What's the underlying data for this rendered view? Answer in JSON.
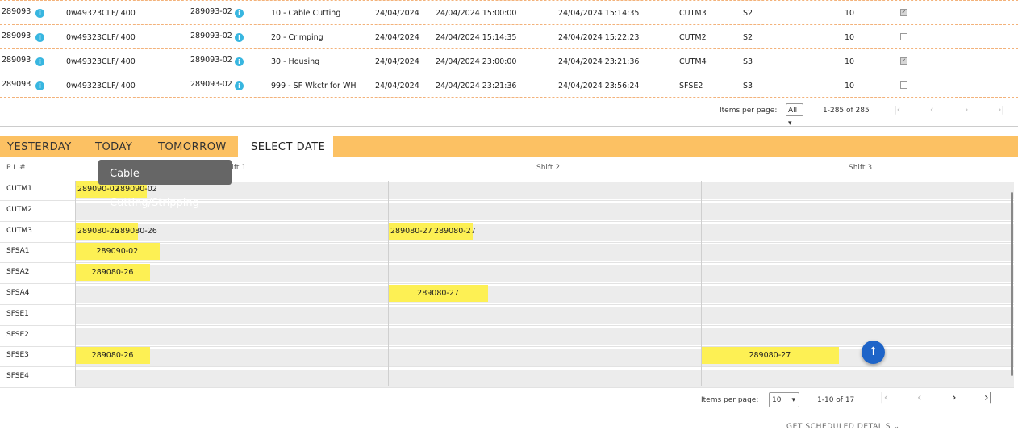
{
  "top_table": {
    "rows": [
      {
        "order": "289093",
        "part": "0w49323CLF/ 400",
        "wo": "289093-02",
        "op": "10 - Cable Cutting",
        "date": "24/04/2024",
        "start": "24/04/2024 15:00:00",
        "end": "24/04/2024 15:14:35",
        "machine": "CUTM3",
        "shift": "S2",
        "qty": "10",
        "checked": true
      },
      {
        "order": "289093",
        "part": "0w49323CLF/ 400",
        "wo": "289093-02",
        "op": "20 - Crimping",
        "date": "24/04/2024",
        "start": "24/04/2024 15:14:35",
        "end": "24/04/2024 15:22:23",
        "machine": "CUTM2",
        "shift": "S2",
        "qty": "10",
        "checked": false
      },
      {
        "order": "289093",
        "part": "0w49323CLF/ 400",
        "wo": "289093-02",
        "op": "30 - Housing",
        "date": "24/04/2024",
        "start": "24/04/2024 23:00:00",
        "end": "24/04/2024 23:21:36",
        "machine": "CUTM4",
        "shift": "S3",
        "qty": "10",
        "checked": true
      },
      {
        "order": "289093",
        "part": "0w49323CLF/ 400",
        "wo": "289093-02",
        "op": "999 - SF Wkctr for WH",
        "date": "24/04/2024",
        "start": "24/04/2024 23:21:36",
        "end": "24/04/2024 23:56:24",
        "machine": "SFSE2",
        "shift": "S3",
        "qty": "10",
        "checked": false
      }
    ],
    "info_icon": "info-icon",
    "pager": {
      "label": "Items per page:",
      "selected": "All",
      "range": "1-285 of 285"
    }
  },
  "tabs": [
    {
      "label": "YESTERDAY",
      "active": false
    },
    {
      "label": "TODAY",
      "active": false
    },
    {
      "label": "TOMORROW",
      "active": false
    },
    {
      "label": "SELECT DATE",
      "active": true
    }
  ],
  "gantt": {
    "row_header": "P L #",
    "shifts": [
      "Shift 1",
      "Shift 2",
      "Shift 3"
    ],
    "rows": [
      {
        "label": "CUTM1",
        "bars": [
          {
            "shift": 0,
            "start": 0.0,
            "end": 0.23,
            "labels": [
              "289090-02",
              "289090-02"
            ]
          }
        ]
      },
      {
        "label": "CUTM2",
        "bars": []
      },
      {
        "label": "CUTM3",
        "bars": [
          {
            "shift": 0,
            "start": 0.0,
            "end": 0.2,
            "labels": [
              "289080-26",
              "289080-26"
            ]
          },
          {
            "shift": 1,
            "start": 0.0,
            "end": 0.27,
            "labels": [
              "289080-27",
              "289080-27"
            ]
          }
        ]
      },
      {
        "label": "SFSA1",
        "bars": [
          {
            "shift": 0,
            "start": 0.0,
            "end": 0.27,
            "labels": [
              "289090-02"
            ]
          }
        ]
      },
      {
        "label": "SFSA2",
        "bars": [
          {
            "shift": 0,
            "start": 0.0,
            "end": 0.24,
            "labels": [
              "289080-26"
            ]
          }
        ]
      },
      {
        "label": "SFSA4",
        "bars": [
          {
            "shift": 1,
            "start": 0.0,
            "end": 0.32,
            "labels": [
              "289080-27"
            ]
          }
        ]
      },
      {
        "label": "SFSE1",
        "bars": []
      },
      {
        "label": "SFSE2",
        "bars": []
      },
      {
        "label": "SFSE3",
        "bars": [
          {
            "shift": 0,
            "start": 0.0,
            "end": 0.24,
            "labels": [
              "289080-26"
            ]
          },
          {
            "shift": 2,
            "start": 0.0,
            "end": 0.44,
            "labels": [
              "289080-27"
            ]
          }
        ]
      },
      {
        "label": "SFSE4",
        "bars": []
      }
    ],
    "colors": {
      "bar": "#fdf054",
      "lane": "#ececec",
      "tab_bar": "#fcc163"
    },
    "tooltip": "Cable Cutting/Stripping",
    "pager": {
      "label": "Items per page:",
      "selected": "10",
      "range": "1-10 of 17"
    },
    "get_scheduled": "GET SCHEDULED DETAILS"
  }
}
